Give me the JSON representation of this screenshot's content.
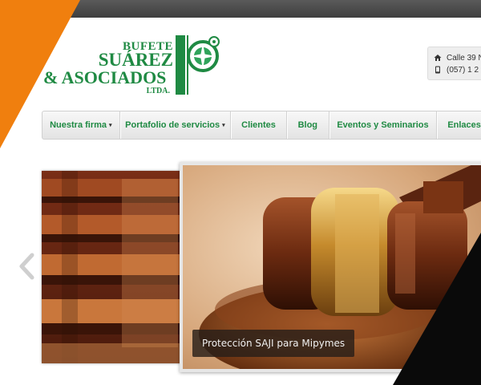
{
  "logo": {
    "line1": "BUFETE",
    "line2": "SUÁREZ",
    "line3": "& ASOCIADOS",
    "line4": "LTDA."
  },
  "contact": {
    "address": "Calle 39 N",
    "phone": "(057) 1 2",
    "address_icon": "home-icon",
    "phone_icon": "phone-icon"
  },
  "nav": {
    "items": [
      {
        "label": "Nuestra firma",
        "has_dropdown": true
      },
      {
        "label": "Portafolio de servicios",
        "has_dropdown": true
      },
      {
        "label": "Clientes",
        "has_dropdown": false
      },
      {
        "label": "Blog",
        "has_dropdown": false
      },
      {
        "label": "Eventos y Seminarios",
        "has_dropdown": false
      },
      {
        "label": "Enlaces",
        "has_dropdown": false
      }
    ],
    "dropdown_glyph": "▾"
  },
  "slider": {
    "caption": "Protección SAJI para Mipymes",
    "prev_icon": "chevron-left-icon"
  },
  "colors": {
    "brand_green": "#1f8a43",
    "accent_orange": "#f07f0e",
    "topbar": "#484848"
  }
}
